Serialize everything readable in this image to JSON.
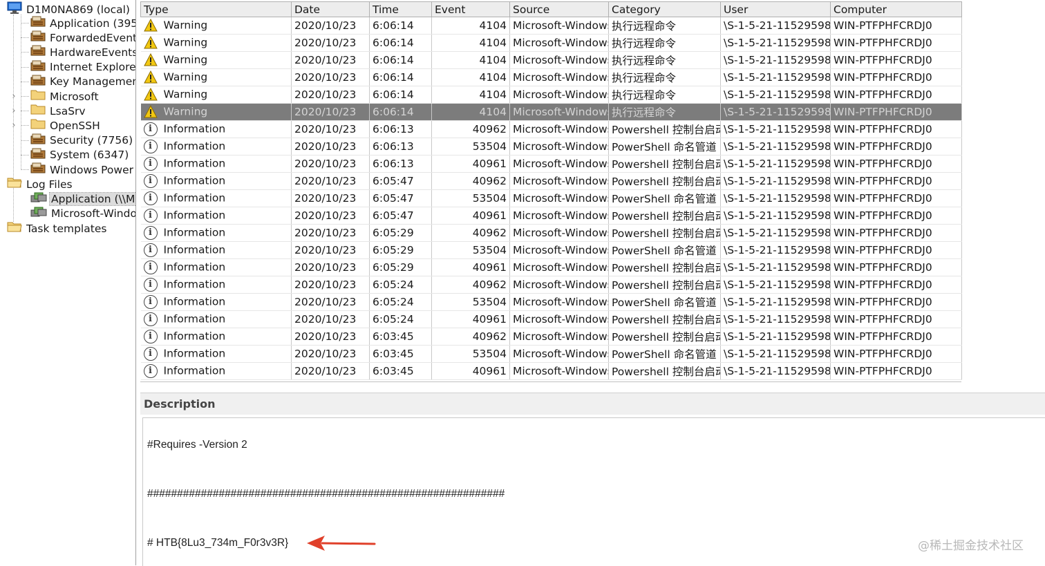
{
  "tree": {
    "root": "D1M0NA869 (local)",
    "logs": [
      {
        "label": "Application (395",
        "icon": "event-log-icon",
        "expandable": false
      },
      {
        "label": "ForwardedEvents",
        "icon": "event-log-icon",
        "expandable": false
      },
      {
        "label": "HardwareEvents",
        "icon": "event-log-icon",
        "expandable": false
      },
      {
        "label": "Internet Explore",
        "icon": "event-log-icon",
        "expandable": false
      },
      {
        "label": "Key Managemen",
        "icon": "event-log-icon",
        "expandable": false
      },
      {
        "label": "Microsoft",
        "icon": "folder-icon",
        "expandable": true
      },
      {
        "label": "LsaSrv",
        "icon": "folder-icon",
        "expandable": true
      },
      {
        "label": "OpenSSH",
        "icon": "folder-icon",
        "expandable": true
      },
      {
        "label": "Security (7756)",
        "icon": "event-log-icon",
        "expandable": false
      },
      {
        "label": "System (6347)",
        "icon": "event-log-icon",
        "expandable": false
      },
      {
        "label": "Windows Power",
        "icon": "event-log-icon",
        "expandable": false
      }
    ],
    "log_files": "Log Files",
    "log_file_items": [
      {
        "label": "Application (\\\\Ma",
        "selected": true
      },
      {
        "label": "Microsoft-Windo",
        "selected": false
      }
    ],
    "task_templates": "Task templates"
  },
  "table": {
    "columns": [
      "Type",
      "Date",
      "Time",
      "Event",
      "Source",
      "Category",
      "User",
      "Computer"
    ],
    "selected_row": 5,
    "rows": [
      {
        "type": "Warning",
        "icon": "warning-icon",
        "date": "2020/10/23",
        "time": "6:06:14",
        "event": "4104",
        "source": "Microsoft-Windows",
        "category": "执行远程命令",
        "user": "\\S-1-5-21-11529598",
        "computer": "WIN-PTFPHFCRDJ0"
      },
      {
        "type": "Warning",
        "icon": "warning-icon",
        "date": "2020/10/23",
        "time": "6:06:14",
        "event": "4104",
        "source": "Microsoft-Windows",
        "category": "执行远程命令",
        "user": "\\S-1-5-21-11529598",
        "computer": "WIN-PTFPHFCRDJ0"
      },
      {
        "type": "Warning",
        "icon": "warning-icon",
        "date": "2020/10/23",
        "time": "6:06:14",
        "event": "4104",
        "source": "Microsoft-Windows",
        "category": "执行远程命令",
        "user": "\\S-1-5-21-11529598",
        "computer": "WIN-PTFPHFCRDJ0"
      },
      {
        "type": "Warning",
        "icon": "warning-icon",
        "date": "2020/10/23",
        "time": "6:06:14",
        "event": "4104",
        "source": "Microsoft-Windows",
        "category": "执行远程命令",
        "user": "\\S-1-5-21-11529598",
        "computer": "WIN-PTFPHFCRDJ0"
      },
      {
        "type": "Warning",
        "icon": "warning-icon",
        "date": "2020/10/23",
        "time": "6:06:14",
        "event": "4104",
        "source": "Microsoft-Windows",
        "category": "执行远程命令",
        "user": "\\S-1-5-21-11529598",
        "computer": "WIN-PTFPHFCRDJ0"
      },
      {
        "type": "Warning",
        "icon": "warning-icon",
        "date": "2020/10/23",
        "time": "6:06:14",
        "event": "4104",
        "source": "Microsoft-Windows",
        "category": "执行远程命令",
        "user": "\\S-1-5-21-11529598",
        "computer": "WIN-PTFPHFCRDJ0"
      },
      {
        "type": "Information",
        "icon": "info-icon",
        "date": "2020/10/23",
        "time": "6:06:13",
        "event": "40962",
        "source": "Microsoft-Windows",
        "category": "Powershell 控制台启动",
        "user": "\\S-1-5-21-11529598",
        "computer": "WIN-PTFPHFCRDJ0"
      },
      {
        "type": "Information",
        "icon": "info-icon",
        "date": "2020/10/23",
        "time": "6:06:13",
        "event": "53504",
        "source": "Microsoft-Windows",
        "category": "PowerShell 命名管道 I",
        "user": "\\S-1-5-21-11529598",
        "computer": "WIN-PTFPHFCRDJ0"
      },
      {
        "type": "Information",
        "icon": "info-icon",
        "date": "2020/10/23",
        "time": "6:06:13",
        "event": "40961",
        "source": "Microsoft-Windows",
        "category": "Powershell 控制台启动",
        "user": "\\S-1-5-21-11529598",
        "computer": "WIN-PTFPHFCRDJ0"
      },
      {
        "type": "Information",
        "icon": "info-icon",
        "date": "2020/10/23",
        "time": "6:05:47",
        "event": "40962",
        "source": "Microsoft-Windows",
        "category": "Powershell 控制台启动",
        "user": "\\S-1-5-21-11529598",
        "computer": "WIN-PTFPHFCRDJ0"
      },
      {
        "type": "Information",
        "icon": "info-icon",
        "date": "2020/10/23",
        "time": "6:05:47",
        "event": "53504",
        "source": "Microsoft-Windows",
        "category": "PowerShell 命名管道 I",
        "user": "\\S-1-5-21-11529598",
        "computer": "WIN-PTFPHFCRDJ0"
      },
      {
        "type": "Information",
        "icon": "info-icon",
        "date": "2020/10/23",
        "time": "6:05:47",
        "event": "40961",
        "source": "Microsoft-Windows",
        "category": "Powershell 控制台启动",
        "user": "\\S-1-5-21-11529598",
        "computer": "WIN-PTFPHFCRDJ0"
      },
      {
        "type": "Information",
        "icon": "info-icon",
        "date": "2020/10/23",
        "time": "6:05:29",
        "event": "40962",
        "source": "Microsoft-Windows",
        "category": "Powershell 控制台启动",
        "user": "\\S-1-5-21-11529598",
        "computer": "WIN-PTFPHFCRDJ0"
      },
      {
        "type": "Information",
        "icon": "info-icon",
        "date": "2020/10/23",
        "time": "6:05:29",
        "event": "53504",
        "source": "Microsoft-Windows",
        "category": "PowerShell 命名管道 I",
        "user": "\\S-1-5-21-11529598",
        "computer": "WIN-PTFPHFCRDJ0"
      },
      {
        "type": "Information",
        "icon": "info-icon",
        "date": "2020/10/23",
        "time": "6:05:29",
        "event": "40961",
        "source": "Microsoft-Windows",
        "category": "Powershell 控制台启动",
        "user": "\\S-1-5-21-11529598",
        "computer": "WIN-PTFPHFCRDJ0"
      },
      {
        "type": "Information",
        "icon": "info-icon",
        "date": "2020/10/23",
        "time": "6:05:24",
        "event": "40962",
        "source": "Microsoft-Windows",
        "category": "Powershell 控制台启动",
        "user": "\\S-1-5-21-11529598",
        "computer": "WIN-PTFPHFCRDJ0"
      },
      {
        "type": "Information",
        "icon": "info-icon",
        "date": "2020/10/23",
        "time": "6:05:24",
        "event": "53504",
        "source": "Microsoft-Windows",
        "category": "PowerShell 命名管道 I",
        "user": "\\S-1-5-21-11529598",
        "computer": "WIN-PTFPHFCRDJ0"
      },
      {
        "type": "Information",
        "icon": "info-icon",
        "date": "2020/10/23",
        "time": "6:05:24",
        "event": "40961",
        "source": "Microsoft-Windows",
        "category": "Powershell 控制台启动",
        "user": "\\S-1-5-21-11529598",
        "computer": "WIN-PTFPHFCRDJ0"
      },
      {
        "type": "Information",
        "icon": "info-icon",
        "date": "2020/10/23",
        "time": "6:03:45",
        "event": "40962",
        "source": "Microsoft-Windows",
        "category": "Powershell 控制台启动",
        "user": "\\S-1-5-21-11529598",
        "computer": "WIN-PTFPHFCRDJ0"
      },
      {
        "type": "Information",
        "icon": "info-icon",
        "date": "2020/10/23",
        "time": "6:03:45",
        "event": "53504",
        "source": "Microsoft-Windows",
        "category": "PowerShell 命名管道 I",
        "user": "\\S-1-5-21-11529598",
        "computer": "WIN-PTFPHFCRDJ0"
      },
      {
        "type": "Information",
        "icon": "info-icon",
        "date": "2020/10/23",
        "time": "6:03:45",
        "event": "40961",
        "source": "Microsoft-Windows",
        "category": "Powershell 控制台启动",
        "user": "\\S-1-5-21-11529598",
        "computer": "WIN-PTFPHFCRDJ0"
      }
    ]
  },
  "description": {
    "heading": "Description",
    "lines": [
      "#Requires -Version 2",
      "############################################################",
      "# HTB{8Lu3_734m_F0r3v3R}"
    ]
  },
  "watermark": "@稀土掘金技术社区",
  "colors": {
    "selected_row_bg": "#7c7c7c",
    "warning_icon": "#f2c811",
    "arrow": "#e0402a",
    "computer_icon": "#1c64c8"
  }
}
